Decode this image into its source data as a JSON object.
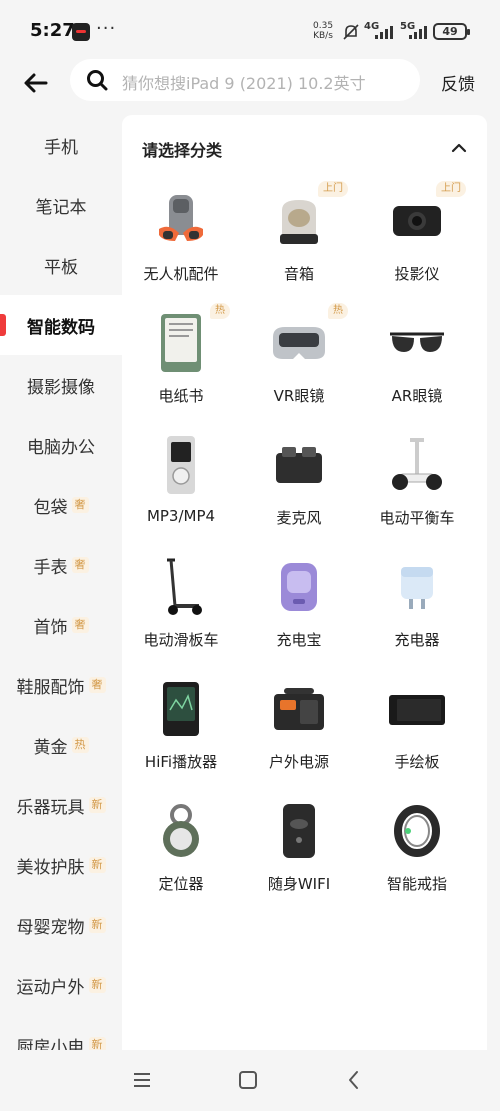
{
  "status_bar": {
    "time": "5:27",
    "more": "···",
    "speed_value": "0.35",
    "speed_unit": "KB/s",
    "net1": "4G",
    "net2": "5G",
    "battery": "49"
  },
  "header": {
    "search_placeholder": "猜你想搜iPad 9 (2021) 10.2英寸",
    "feedback_label": "反馈"
  },
  "sidebar": {
    "items": [
      {
        "label": "手机",
        "tag": ""
      },
      {
        "label": "笔记本",
        "tag": ""
      },
      {
        "label": "平板",
        "tag": ""
      },
      {
        "label": "智能数码",
        "tag": "",
        "active": true
      },
      {
        "label": "摄影摄像",
        "tag": ""
      },
      {
        "label": "电脑办公",
        "tag": ""
      },
      {
        "label": "包袋",
        "tag": "奢"
      },
      {
        "label": "手表",
        "tag": "奢"
      },
      {
        "label": "首饰",
        "tag": "奢"
      },
      {
        "label": "鞋服配饰",
        "tag": "奢"
      },
      {
        "label": "黄金",
        "tag": "热"
      },
      {
        "label": "乐器玩具",
        "tag": "新"
      },
      {
        "label": "美妆护肤",
        "tag": "新"
      },
      {
        "label": "母婴宠物",
        "tag": "新"
      },
      {
        "label": "运动户外",
        "tag": "新"
      },
      {
        "label": "厨房小电",
        "tag": "新"
      }
    ]
  },
  "main": {
    "title": "请选择分类",
    "categories": [
      {
        "label": "无人机配件",
        "tag": "",
        "icon": "drone-icon"
      },
      {
        "label": "音箱",
        "tag": "上门",
        "icon": "speaker-icon"
      },
      {
        "label": "投影仪",
        "tag": "上门",
        "icon": "projector-icon"
      },
      {
        "label": "电纸书",
        "tag": "热",
        "icon": "ereader-icon"
      },
      {
        "label": "VR眼镜",
        "tag": "热",
        "icon": "vr-headset-icon"
      },
      {
        "label": "AR眼镜",
        "tag": "",
        "icon": "ar-glasses-icon"
      },
      {
        "label": "MP3/MP4",
        "tag": "",
        "icon": "mp3-player-icon"
      },
      {
        "label": "麦克风",
        "tag": "",
        "icon": "microphone-icon"
      },
      {
        "label": "电动平衡车",
        "tag": "",
        "icon": "balance-scooter-icon"
      },
      {
        "label": "电动滑板车",
        "tag": "",
        "icon": "kick-scooter-icon"
      },
      {
        "label": "充电宝",
        "tag": "",
        "icon": "power-bank-icon"
      },
      {
        "label": "充电器",
        "tag": "",
        "icon": "charger-icon"
      },
      {
        "label": "HiFi播放器",
        "tag": "",
        "icon": "hifi-player-icon"
      },
      {
        "label": "户外电源",
        "tag": "",
        "icon": "outdoor-power-icon"
      },
      {
        "label": "手绘板",
        "tag": "",
        "icon": "drawing-tablet-icon"
      },
      {
        "label": "定位器",
        "tag": "",
        "icon": "tracker-icon"
      },
      {
        "label": "随身WIFI",
        "tag": "",
        "icon": "portable-wifi-icon"
      },
      {
        "label": "智能戒指",
        "tag": "",
        "icon": "smart-ring-icon"
      }
    ]
  }
}
